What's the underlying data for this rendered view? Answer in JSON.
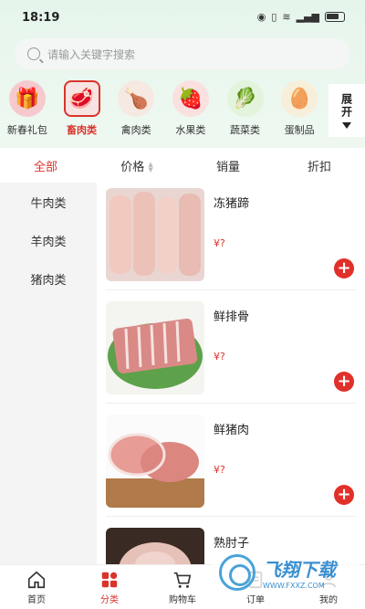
{
  "status_bar": {
    "time": "18:19"
  },
  "search": {
    "placeholder": "请输入关键字搜索"
  },
  "categories": [
    {
      "label": "新春礼包",
      "icon": "gift-box-icon"
    },
    {
      "label": "畜肉类",
      "icon": "red-meat-icon",
      "active": true
    },
    {
      "label": "禽肉类",
      "icon": "poultry-icon"
    },
    {
      "label": "水果类",
      "icon": "strawberry-icon"
    },
    {
      "label": "蔬菜类",
      "icon": "vegetable-icon"
    },
    {
      "label": "蛋制品",
      "icon": "egg-icon"
    }
  ],
  "expand_label": "展开",
  "sort_tabs": [
    "全部",
    "价格",
    "销量",
    "折扣"
  ],
  "subcategories": [
    "牛肉类",
    "羊肉类",
    "猪肉类"
  ],
  "products": [
    {
      "name": "冻猪蹄",
      "price": "¥?"
    },
    {
      "name": "鲜排骨",
      "price": "¥?"
    },
    {
      "name": "鲜猪肉",
      "price": "¥?"
    },
    {
      "name": "熟肘子",
      "price": ""
    }
  ],
  "tabbar": [
    {
      "label": "首页",
      "icon": "home-icon"
    },
    {
      "label": "分类",
      "icon": "category-icon",
      "active": true
    },
    {
      "label": "购物车",
      "icon": "cart-icon"
    },
    {
      "label": "订单",
      "icon": "order-icon"
    },
    {
      "label": "我的",
      "icon": "profile-icon"
    }
  ],
  "watermark": {
    "text": "飞翔下载",
    "url": "WWW.FXXZ.COM"
  },
  "colors": {
    "accent": "#d9342b",
    "header_bg": "#e6f5ec"
  }
}
